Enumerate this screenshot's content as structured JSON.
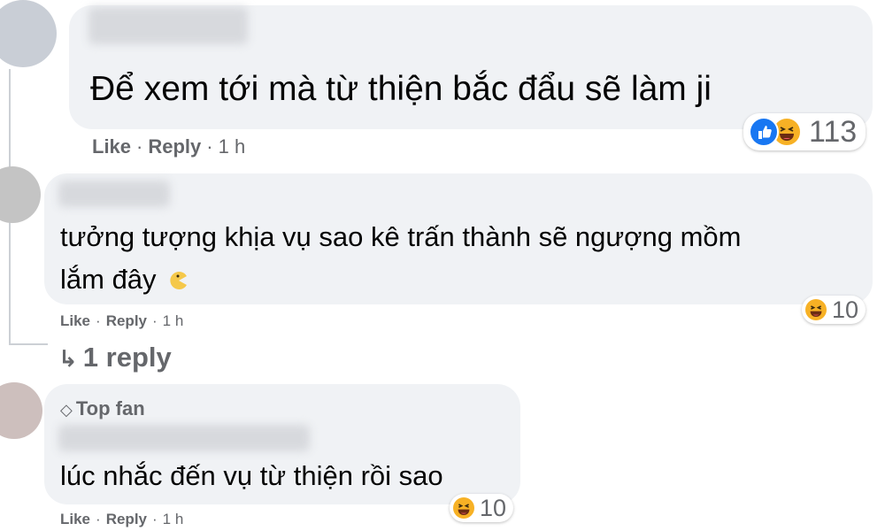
{
  "comments": [
    {
      "text": "Để xem tới mà từ thiện bắc đẩu sẽ làm ji",
      "actions": {
        "like": "Like",
        "reply": "Reply",
        "time": "1 h"
      },
      "reaction_count": "113",
      "reaction_icons": [
        "like-icon",
        "haha-icon"
      ]
    },
    {
      "text_line1": "tưởng tượng khịa vụ sao kê trấn thành sẽ ngượng mồm",
      "text_line2": "lắm đây",
      "actions": {
        "like": "Like",
        "reply": "Reply",
        "time": "1 h"
      },
      "reaction_count": "10",
      "reaction_icons": [
        "haha-icon"
      ],
      "replies_link": "1 reply"
    },
    {
      "badge": "Top fan",
      "text": "lúc nhắc đến vụ từ thiện rồi sao",
      "actions": {
        "like": "Like",
        "reply": "Reply",
        "time": "1 h"
      },
      "reaction_count": "10",
      "reaction_icons": [
        "haha-icon"
      ]
    }
  ],
  "colors": {
    "bubble": "#f0f2f5",
    "secondary_text": "#65676b",
    "like_blue": "#1877f2",
    "haha_yellow": "#f7b125"
  }
}
